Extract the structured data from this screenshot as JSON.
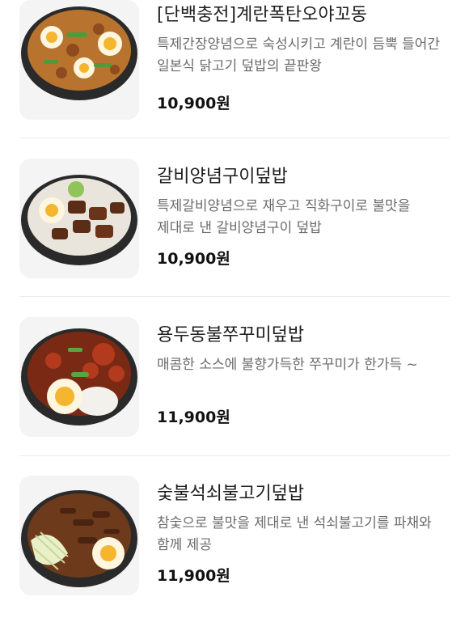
{
  "menu": {
    "items": [
      {
        "name": "[단백충전]계란폭탄오야꼬동",
        "description": "특제간장양념으로 숙성시키고 계란이 듬뿍 들어간 일본식 닭고기 덮밥의 끝판왕",
        "price": "10,900원",
        "image_icon": "oyakodon-rice-bowl-photo"
      },
      {
        "name": "갈비양념구이덮밥",
        "description": "특제갈비양념으로 재우고 직화구이로 불맛을 제대로 낸 갈비양념구이 덮밥",
        "price": "10,900원",
        "image_icon": "galbi-rice-bowl-photo"
      },
      {
        "name": "용두동불쭈꾸미덮밥",
        "description": "매콤한 소스에 불향가득한 쭈꾸미가 한가득 ~",
        "price": "11,900원",
        "image_icon": "webfoot-octopus-rice-bowl-photo"
      },
      {
        "name": "숯불석쇠불고기덮밥",
        "description": "참숯으로 불맛을 제대로 낸 석쇠불고기를 파채와 함께 제공",
        "price": "11,900원",
        "image_icon": "bulgogi-rice-bowl-photo"
      }
    ]
  }
}
